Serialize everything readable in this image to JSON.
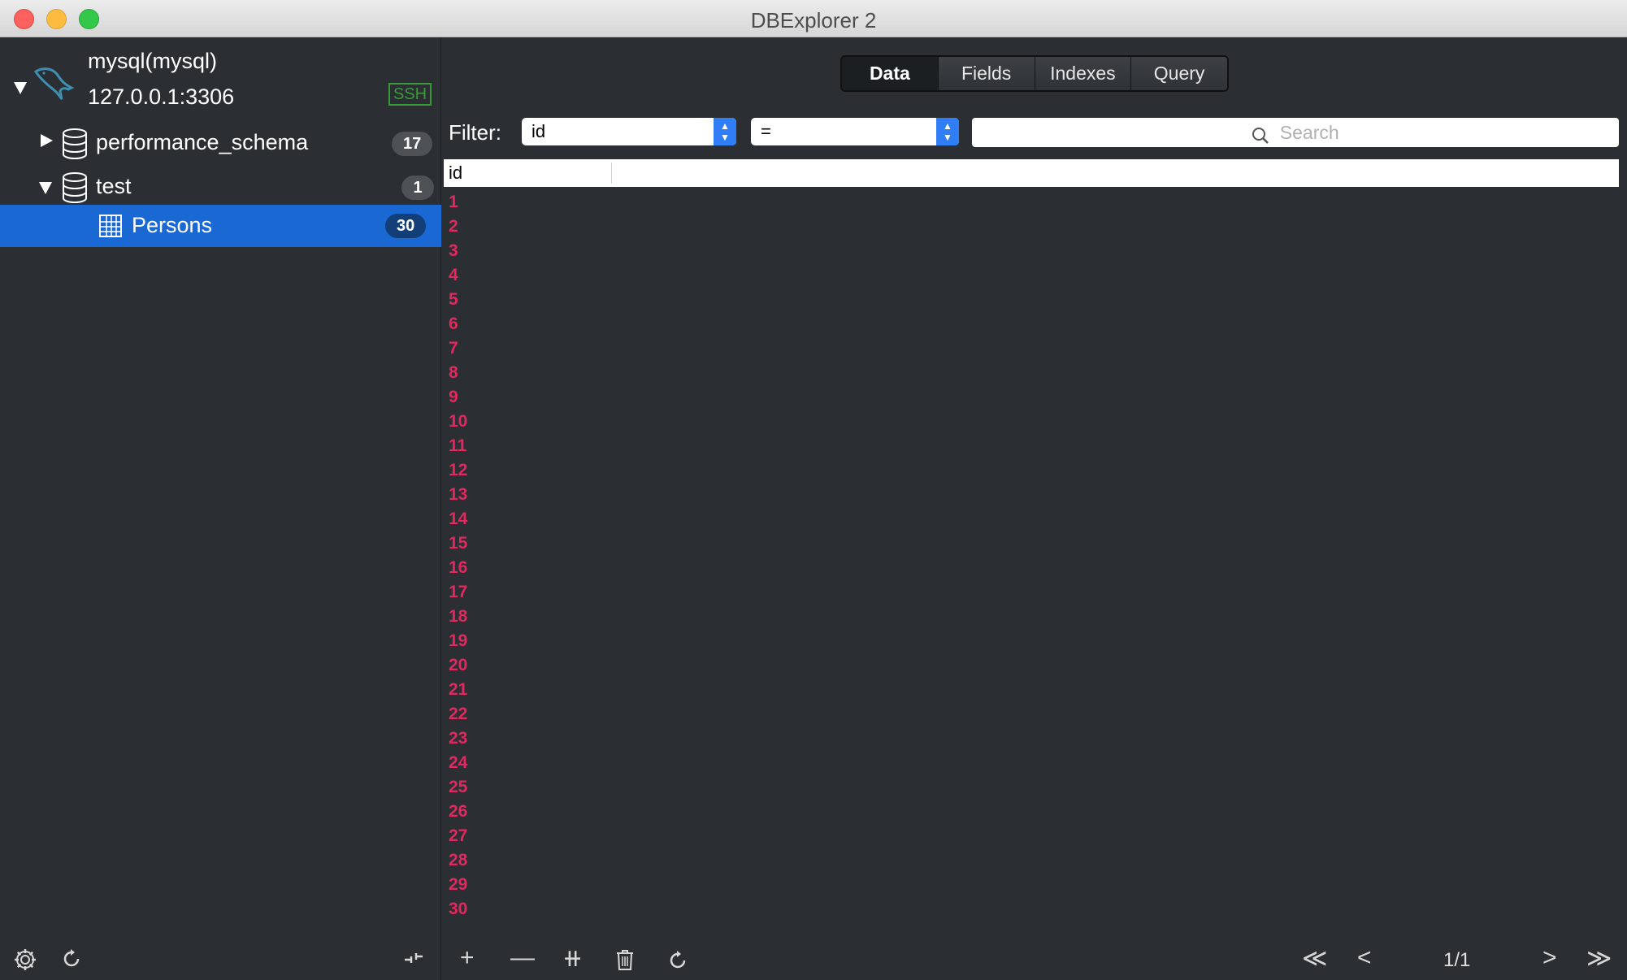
{
  "window": {
    "title": "DBExplorer 2"
  },
  "sidebar": {
    "connection": {
      "name": "mysql(mysql)",
      "host": "127.0.0.1:3306",
      "ssh_label": "SSH"
    },
    "databases": [
      {
        "name": "performance_schema",
        "count": "17",
        "expanded": false
      },
      {
        "name": "test",
        "count": "1",
        "expanded": true
      }
    ],
    "tables": [
      {
        "name": "Persons",
        "count": "30",
        "selected": true
      }
    ],
    "footer": {
      "settings_icon": "gear-icon",
      "refresh_icon": "refresh-icon",
      "disconnect_icon": "plug-icon"
    }
  },
  "main": {
    "tabs": [
      {
        "label": "Data",
        "active": true
      },
      {
        "label": "Fields",
        "active": false
      },
      {
        "label": "Indexes",
        "active": false
      },
      {
        "label": "Query",
        "active": false
      }
    ],
    "filter": {
      "label": "Filter:",
      "field": "id",
      "operator": "=",
      "search_placeholder": "Search"
    },
    "columns": [
      "id"
    ],
    "rows": [
      "1",
      "2",
      "3",
      "4",
      "5",
      "6",
      "7",
      "8",
      "9",
      "10",
      "11",
      "12",
      "13",
      "14",
      "15",
      "16",
      "17",
      "18",
      "19",
      "20",
      "21",
      "22",
      "23",
      "24",
      "25",
      "26",
      "27",
      "28",
      "29",
      "30"
    ],
    "toolbar": {
      "add": "+",
      "remove": "—",
      "add_column": "⧺",
      "delete_icon": "trash-icon",
      "refresh_icon": "refresh-icon"
    },
    "pager": {
      "first": "≪",
      "prev": "<",
      "page": "1/1",
      "next": ">",
      "last": "≫"
    }
  },
  "colors": {
    "accent": "#1a68d3",
    "id_value": "#e3275f",
    "ssh_green": "#3a9a3a"
  }
}
